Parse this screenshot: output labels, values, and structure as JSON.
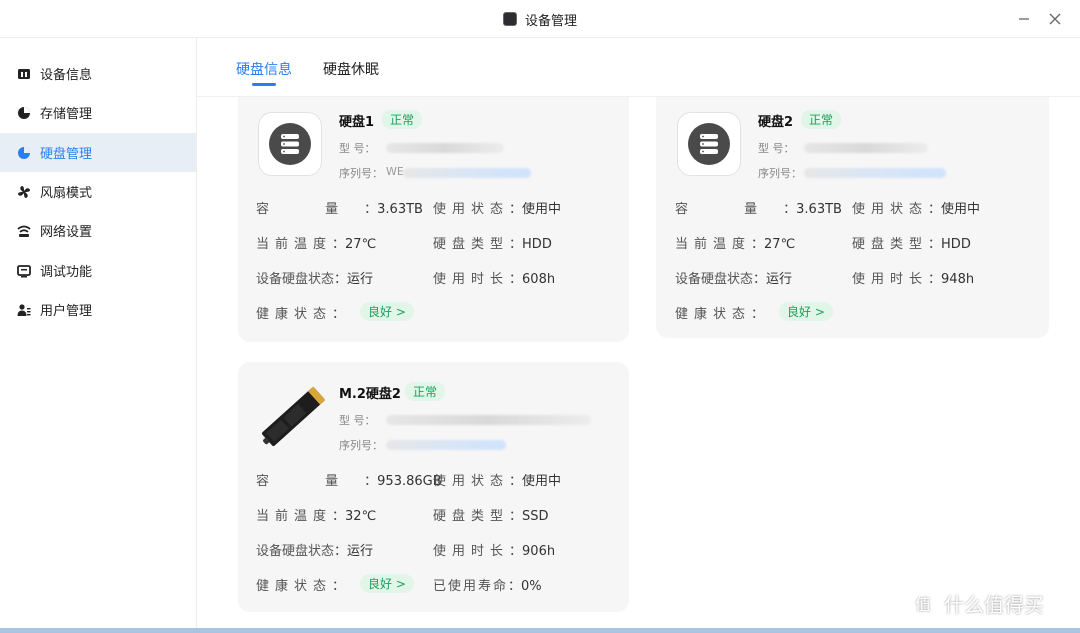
{
  "window": {
    "title": "设备管理"
  },
  "sidebar": {
    "items": [
      {
        "label": "设备信息",
        "icon": "device-info-icon"
      },
      {
        "label": "存储管理",
        "icon": "storage-pie-icon"
      },
      {
        "label": "硬盘管理",
        "icon": "disk-pie-icon",
        "active": true
      },
      {
        "label": "风扇模式",
        "icon": "fan-icon"
      },
      {
        "label": "网络设置",
        "icon": "wifi-icon"
      },
      {
        "label": "调试功能",
        "icon": "monitor-icon"
      },
      {
        "label": "用户管理",
        "icon": "users-icon"
      }
    ]
  },
  "tabs": [
    {
      "label": "硬盘信息",
      "active": true
    },
    {
      "label": "硬盘休眠",
      "active": false
    }
  ],
  "disks": [
    {
      "name": "硬盘1",
      "status": "正常",
      "model_label": "型 号：",
      "serial_label": "序列号：",
      "serial_visible": "WE",
      "capacity_label": "容 量",
      "capacity": "3.63TB",
      "use_state_label": "使用状态",
      "use_state": "使用中",
      "temp_label": "当前温度",
      "temp": "27℃",
      "type_label": "硬盘类型",
      "type": "HDD",
      "dev_state_label": "设备硬盘状态",
      "dev_state": "运行",
      "duration_label": "使用时长",
      "duration": "608h",
      "health_label": "健康状态",
      "health": "良好 >"
    },
    {
      "name": "硬盘2",
      "status": "正常",
      "model_label": "型 号：",
      "serial_label": "序列号：",
      "capacity_label": "容 量",
      "capacity": "3.63TB",
      "use_state_label": "使用状态",
      "use_state": "使用中",
      "temp_label": "当前温度",
      "temp": "27℃",
      "type_label": "硬盘类型",
      "type": "HDD",
      "dev_state_label": "设备硬盘状态",
      "dev_state": "运行",
      "duration_label": "使用时长",
      "duration": "948h",
      "health_label": "健康状态",
      "health": "良好 >"
    },
    {
      "name": "M.2硬盘2",
      "status": "正常",
      "model_label": "型 号：",
      "serial_label": "序列号：",
      "capacity_label": "容 量",
      "capacity": "953.86GB",
      "use_state_label": "使用状态",
      "use_state": "使用中",
      "temp_label": "当前温度",
      "temp": "32℃",
      "type_label": "硬盘类型",
      "type": "SSD",
      "dev_state_label": "设备硬盘状态",
      "dev_state": "运行",
      "duration_label": "使用时长",
      "duration": "906h",
      "health_label": "健康状态",
      "health": "良好 >",
      "life_label": "已使用寿命",
      "life": "0%"
    }
  ],
  "watermark": {
    "text": "什么值得买",
    "logo_char": "值"
  },
  "colors": {
    "accent": "#2a7ff0",
    "ok_green": "#1e9e5a",
    "ok_bg": "#e1f5e8",
    "card_bg": "#f6f6f7"
  }
}
